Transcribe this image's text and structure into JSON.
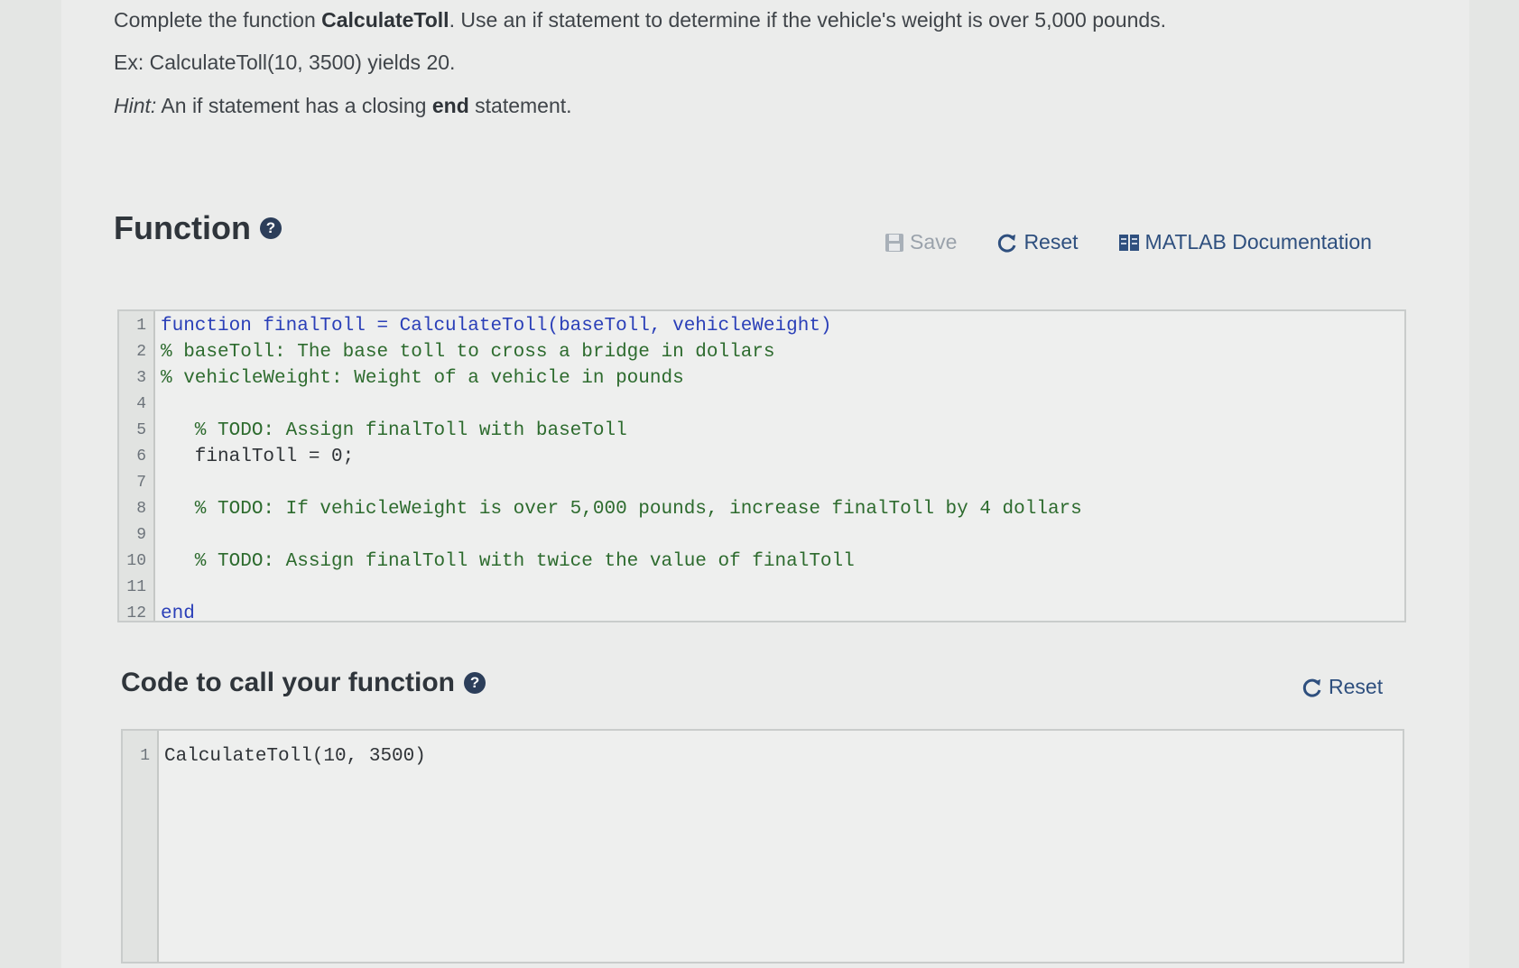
{
  "instructions": {
    "line1_pre": "Complete the function ",
    "line1_bold": "CalculateToll",
    "line1_post": ". Use an if statement to determine if the vehicle's weight is over 5,000 pounds.",
    "line2": "Ex: CalculateToll(10, 3500) yields 20.",
    "hint_label": "Hint:",
    "hint_pre": " An if statement has a closing ",
    "hint_bold": "end",
    "hint_post": " statement."
  },
  "function_section": {
    "title": "Function",
    "help_icon": "question-circle-icon",
    "toolbar": {
      "save": "Save",
      "reset": "Reset",
      "documentation": "MATLAB Documentation"
    },
    "lines": [
      {
        "n": "1",
        "code": "function finalToll = CalculateToll(baseToll, vehicleWeight)",
        "kind": "kw"
      },
      {
        "n": "2",
        "code": "% baseToll: The base toll to cross a bridge in dollars",
        "kind": "cm"
      },
      {
        "n": "3",
        "code": "% vehicleWeight: Weight of a vehicle in pounds",
        "kind": "cm"
      },
      {
        "n": "4",
        "code": "",
        "kind": "tx"
      },
      {
        "n": "5",
        "code": "   % TODO: Assign finalToll with baseToll",
        "kind": "cm"
      },
      {
        "n": "6",
        "code": "   finalToll = 0;",
        "kind": "tx"
      },
      {
        "n": "7",
        "code": "",
        "kind": "tx"
      },
      {
        "n": "8",
        "code": "   % TODO: If vehicleWeight is over 5,000 pounds, increase finalToll by 4 dollars",
        "kind": "cm"
      },
      {
        "n": "9",
        "code": "",
        "kind": "tx"
      },
      {
        "n": "10",
        "code": "   % TODO: Assign finalToll with twice the value of finalToll",
        "kind": "cm"
      },
      {
        "n": "11",
        "code": "",
        "kind": "tx"
      },
      {
        "n": "12",
        "code": "end",
        "kind": "kw"
      }
    ]
  },
  "call_section": {
    "title": "Code to call your function",
    "help_icon": "question-circle-icon",
    "reset": "Reset",
    "lines": [
      {
        "n": "1",
        "code": "CalculateToll(10, 3500)",
        "kind": "tx"
      }
    ]
  }
}
